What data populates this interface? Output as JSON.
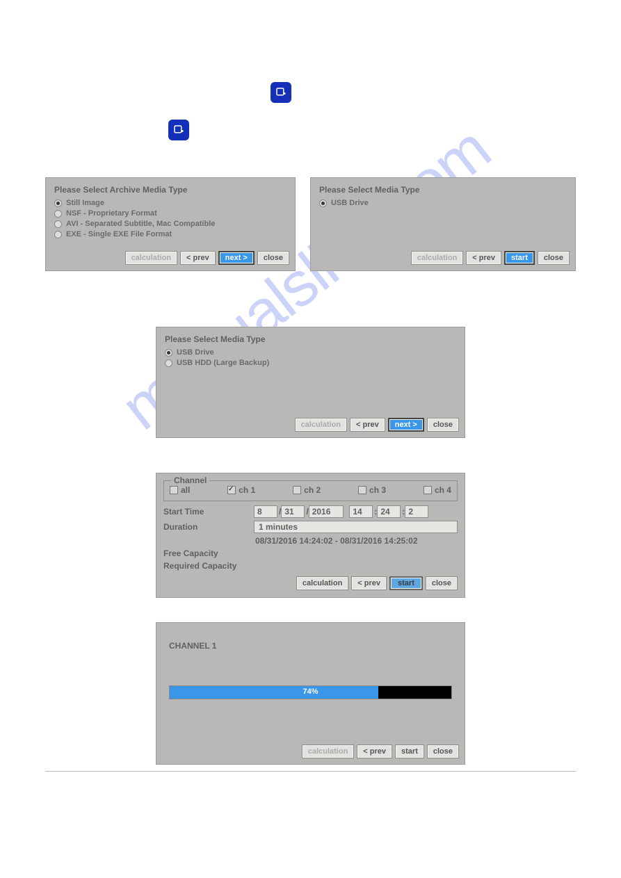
{
  "watermark": "manualslive.com",
  "dialog1": {
    "title": "Please  Select  Archive  Media  Type",
    "options": [
      "Still  Image",
      "NSF  -  Proprietary  Format",
      "AVI  -  Separated  Subtitle,  Mac  Compatible",
      "EXE  -  Single  EXE  File  Format"
    ],
    "selected": 0,
    "buttons": {
      "calc": "calculation",
      "prev": "<  prev",
      "next": "next >",
      "close": "close"
    }
  },
  "dialog2": {
    "title": "Please  Select  Media  Type",
    "options": [
      "USB  Drive"
    ],
    "selected": 0,
    "buttons": {
      "calc": "calculation",
      "prev": "<  prev",
      "start": "start",
      "close": "close"
    }
  },
  "dialog3": {
    "title": "Please  Select  Media  Type",
    "options": [
      "USB  Drive",
      "USB  HDD  (Large  Backup)"
    ],
    "selected": 0,
    "buttons": {
      "calc": "calculation",
      "prev": "<  prev",
      "next": "next >",
      "close": "close"
    }
  },
  "dialog4": {
    "legend": "Channel",
    "channels": {
      "all": "all",
      "ch1": "ch 1",
      "ch2": "ch 2",
      "ch3": "ch 3",
      "ch4": "ch 4"
    },
    "checked": "ch1",
    "start_label": "Start  Time",
    "date": {
      "m": "8",
      "d": "31",
      "y": "2016",
      "hh": "14",
      "mm": "24",
      "ss": "2"
    },
    "duration_label": "Duration",
    "duration_value": "1  minutes",
    "range": "08/31/2016  14:24:02  -  08/31/2016  14:25:02",
    "free_label": "Free  Capacity",
    "req_label": "Required  Capacity",
    "buttons": {
      "calc": "calculation",
      "prev": "<  prev",
      "start": "start",
      "close": "close"
    }
  },
  "dialog5": {
    "channel": "CHANNEL  1",
    "progress_pct": 74,
    "progress_text": "74%",
    "buttons": {
      "calc": "calculation",
      "prev": "<  prev",
      "start": "start",
      "close": "close"
    }
  }
}
